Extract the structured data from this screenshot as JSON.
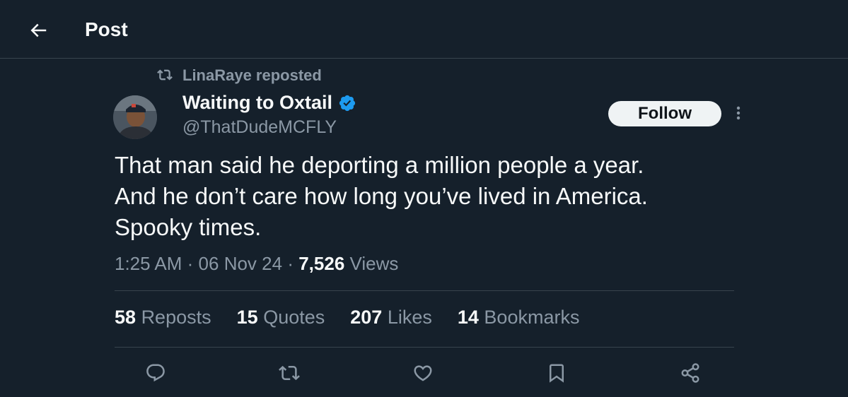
{
  "header": {
    "title": "Post",
    "back_icon": "arrow-left-icon"
  },
  "repost": {
    "icon": "repost-icon",
    "text": "LinaRaye reposted"
  },
  "author": {
    "name": "Waiting to Oxtail",
    "verified_icon": "verified-badge-icon",
    "handle": "@ThatDudeMCFLY",
    "follow_label": "Follow"
  },
  "tweet": {
    "lines": [
      "That man said he deporting a million people a year.",
      "And he don’t care how long you’ve lived in America.",
      "Spooky times."
    ],
    "time": "1:25 AM",
    "date": "06 Nov 24",
    "sep": "·",
    "views_count": "7,526",
    "views_label": "Views"
  },
  "stats": [
    {
      "count": "58",
      "label": "Reposts"
    },
    {
      "count": "15",
      "label": "Quotes"
    },
    {
      "count": "207",
      "label": "Likes"
    },
    {
      "count": "14",
      "label": "Bookmarks"
    }
  ],
  "actions": [
    "reply-icon",
    "repost-icon",
    "like-icon",
    "bookmark-icon",
    "share-icon"
  ],
  "colors": {
    "background": "#15202b",
    "text": "#f7f9f9",
    "muted": "#8b98a5",
    "divider": "#38444d",
    "verified": "#1d9bf0"
  }
}
